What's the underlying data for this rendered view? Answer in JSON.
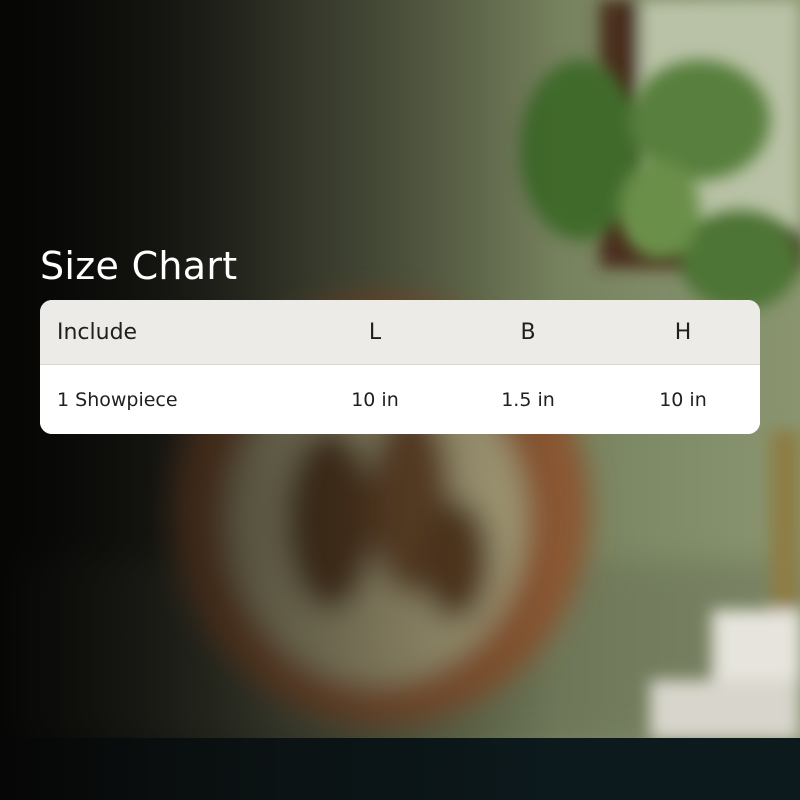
{
  "title": "Size Chart",
  "table": {
    "headers": [
      "Include",
      "L",
      "B",
      "H"
    ],
    "rows": [
      [
        "1 Showpiece",
        "10 in",
        "1.5 in",
        "10 in"
      ]
    ]
  },
  "colors": {
    "header_bg": "#edebe7",
    "row_bg": "#ffffff",
    "title_text": "#ffffff",
    "cell_text": "#1f1f1f"
  }
}
